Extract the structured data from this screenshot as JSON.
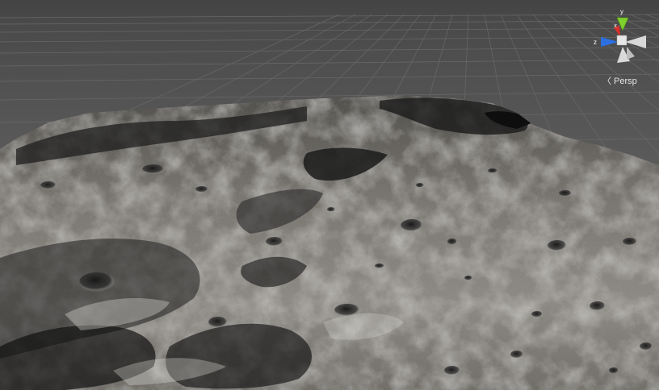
{
  "scene_view": {
    "projection_label": "Persp",
    "projection_icon": "chevron-left-icon",
    "gizmo": {
      "axis_x": "x",
      "axis_y": "y",
      "axis_z": "z",
      "colors": {
        "x": "#d8302b",
        "y": "#7fcf2e",
        "z": "#2c6fe0",
        "neutral": "#d9d9d9"
      }
    },
    "environment": {
      "background_color": "#4a4a4a",
      "grid_color": "#6a6a6a",
      "terrain_type": "lunar-surface-terrain"
    }
  }
}
